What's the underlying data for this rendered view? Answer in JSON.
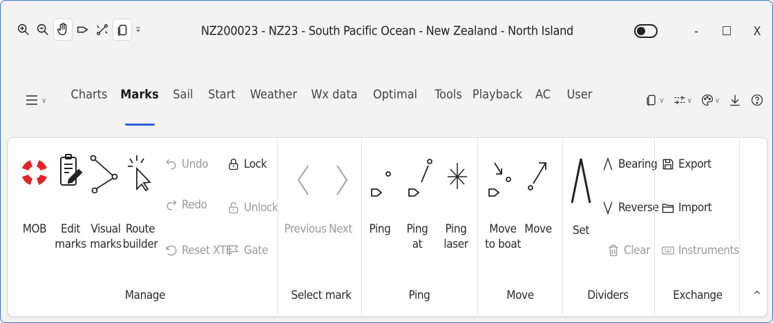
{
  "window": {
    "title": "NZ200023 - NZ23 - South Pacific Ocean - New Zealand - North Island",
    "controls": {
      "minimize": "-",
      "maximize": "☐",
      "close": "X"
    }
  },
  "quick_access": [
    "zoom-in-icon",
    "zoom-out-icon",
    "pan-hand-icon",
    "mark-icon",
    "no-route-icon",
    "copy-icon",
    "customize-icon"
  ],
  "tabs": {
    "items": [
      "Charts",
      "Marks",
      "Sail",
      "Start",
      "Weather",
      "Wx data",
      "Optimal",
      "Tools",
      "Playback",
      "AC",
      "User"
    ],
    "active": "Marks"
  },
  "ribbon": {
    "manage": {
      "label": "Manage",
      "mob": "MOB",
      "edit_marks": [
        "Edit",
        "marks"
      ],
      "visual_marks": [
        "Visual",
        "marks"
      ],
      "route_builder": [
        "Route",
        "builder"
      ],
      "undo": "Undo",
      "redo": "Redo",
      "reset_xte": "Reset XTE",
      "lock": "Lock",
      "unlock": "Unlock",
      "gate": "Gate"
    },
    "select_mark": {
      "label": "Select mark",
      "previous": "Previous",
      "next": "Next"
    },
    "ping": {
      "label": "Ping",
      "ping": "Ping",
      "ping_at": [
        "Ping",
        "at"
      ],
      "ping_laser": [
        "Ping",
        "laser"
      ]
    },
    "move": {
      "label": "Move",
      "move_to_boat": [
        "Move",
        "to boat"
      ],
      "move": "Move"
    },
    "dividers": {
      "label": "Dividers",
      "set": "Set",
      "bearing": "Bearing",
      "reverse": "Reverse",
      "clear": "Clear"
    },
    "exchange": {
      "label": "Exchange",
      "export": "Export",
      "import": "Import",
      "instruments": "Instruments"
    },
    "collapse": "^"
  },
  "colors": {
    "accent": "#2b5fd0",
    "mob_red": "#e0242b",
    "border": "#3b6fd4"
  }
}
